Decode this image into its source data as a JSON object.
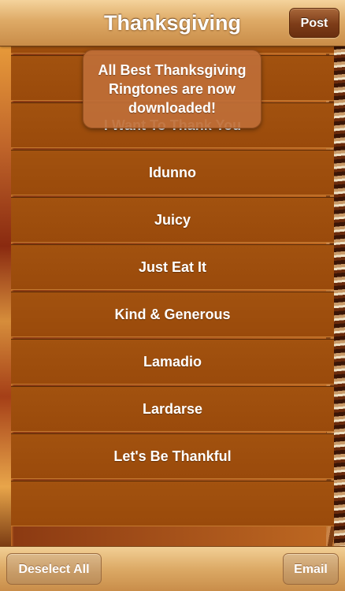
{
  "navbar": {
    "title": "Thanksgiving",
    "post_label": "Post"
  },
  "toast": {
    "message": "All Best Thanksgiving Ringtones are now downloaded!"
  },
  "list": {
    "items": [
      "",
      "",
      "I Want To Thank You",
      "Idunno",
      "Juicy",
      "Just Eat It",
      "Kind & Generous",
      "Lamadio",
      "Lardarse",
      "Let's Be Thankful",
      ""
    ]
  },
  "toolbar": {
    "deselect_label": "Deselect All",
    "email_label": "Email"
  },
  "colors": {
    "row_brown": "#9a4a0b",
    "bar_tan": "#deaa66",
    "button_brown": "#7d3c18"
  }
}
